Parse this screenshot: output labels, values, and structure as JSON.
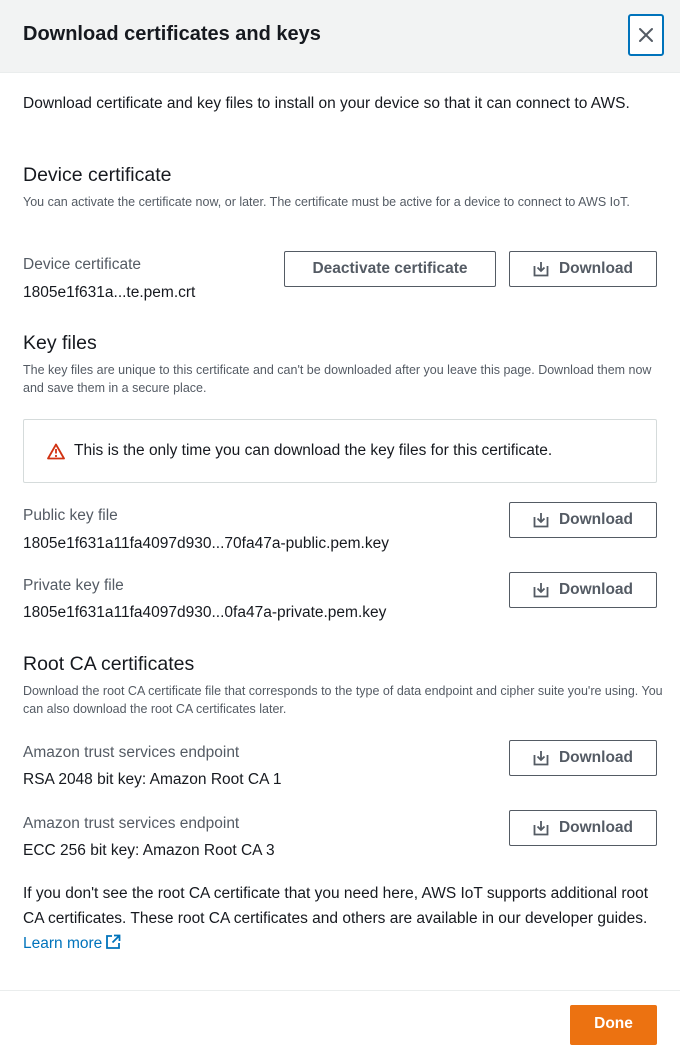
{
  "dialog": {
    "title": "Download certificates and keys",
    "intro": "Download certificate and key files to install on your device so that it can connect to AWS."
  },
  "device_certificate": {
    "heading": "Device certificate",
    "description": "You can activate the certificate now, or later. The certificate must be active for a device to connect to AWS IoT.",
    "label": "Device certificate",
    "filename": "1805e1f631a...te.pem.crt",
    "deactivate_label": "Deactivate certificate",
    "download_label": "Download"
  },
  "key_files": {
    "heading": "Key files",
    "description": "The key files are unique to this certificate and can't be downloaded after you leave this page. Download them now and save them in a secure place.",
    "alert": "This is the only time you can download the key files for this certificate.",
    "public_label": "Public key file",
    "public_filename": "1805e1f631a11fa4097d930...70fa47a-public.pem.key",
    "private_label": "Private key file",
    "private_filename": "1805e1f631a11fa4097d930...0fa47a-private.pem.key",
    "download_label": "Download"
  },
  "root_ca": {
    "heading": "Root CA certificates",
    "description": "Download the root CA certificate file that corresponds to the type of data endpoint and cipher suite you're using. You can also download the root CA certificates later.",
    "items": [
      {
        "label": "Amazon trust services endpoint",
        "value": "RSA 2048 bit key: Amazon Root CA 1"
      },
      {
        "label": "Amazon trust services endpoint",
        "value": "ECC 256 bit key: Amazon Root CA 3"
      }
    ],
    "download_label": "Download"
  },
  "footer_note": {
    "text": "If you don't see the root CA certificate that you need here, AWS IoT supports additional root CA certificates. These root CA certificates and others are available in our developer guides.",
    "link": "Learn more"
  },
  "done_label": "Done",
  "colors": {
    "accent": "#ec7211",
    "link": "#0073bb",
    "warning": "#d13212"
  }
}
